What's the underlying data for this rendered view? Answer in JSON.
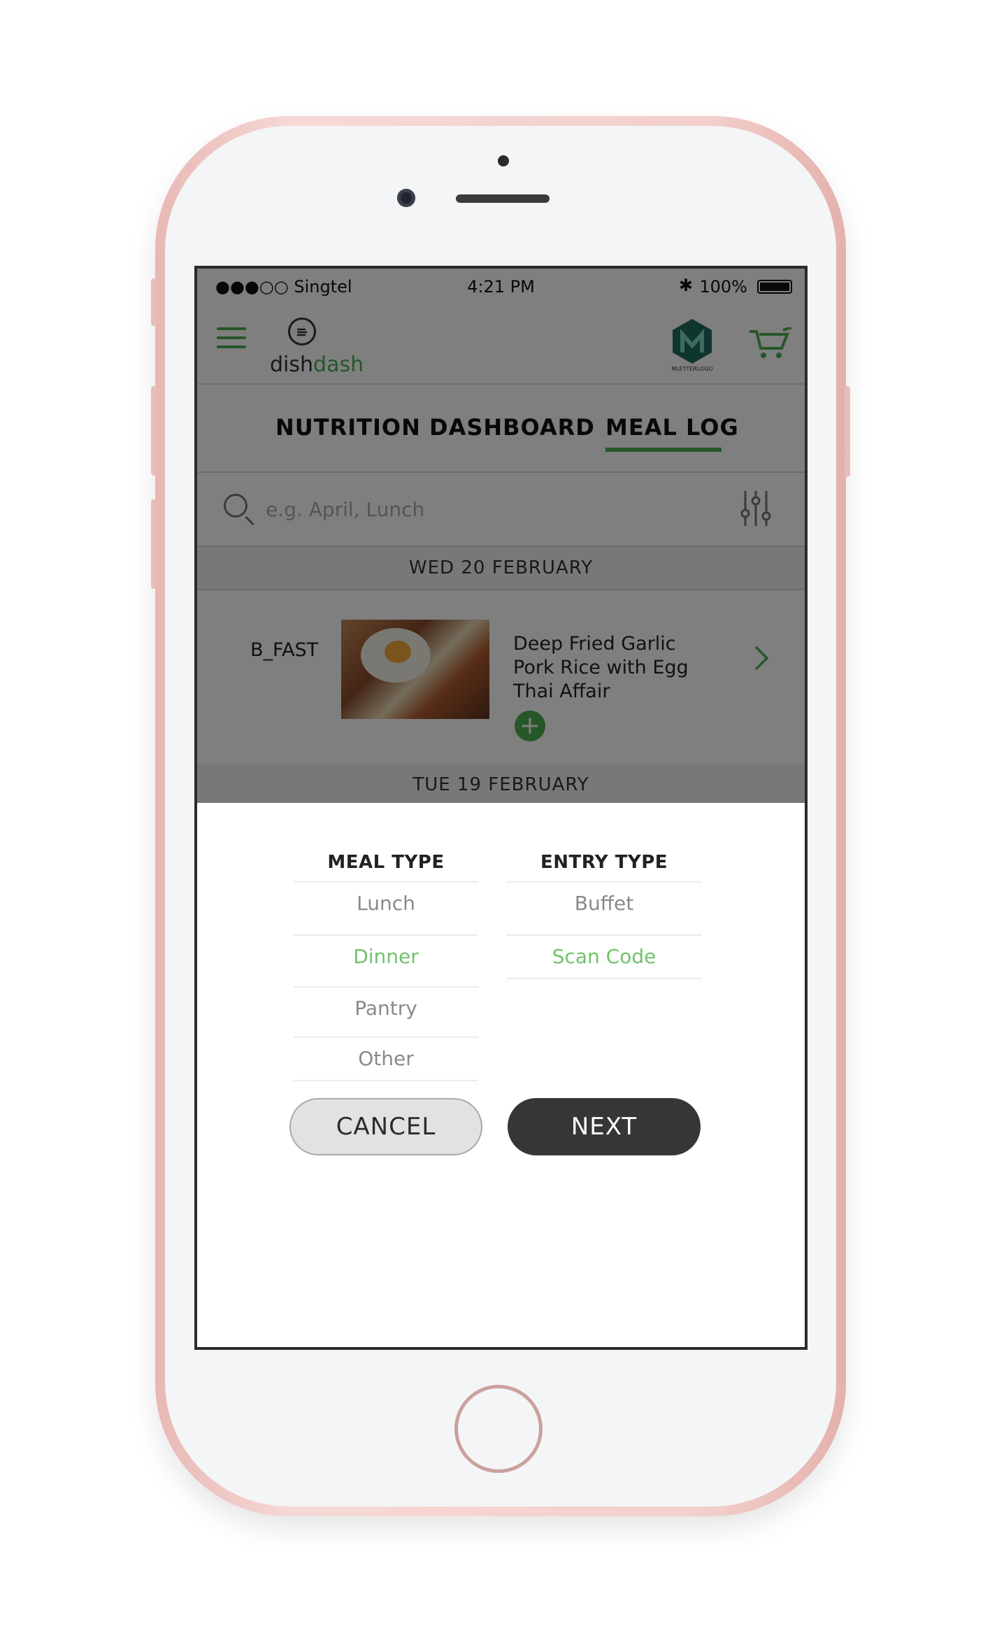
{
  "status_bar": {
    "carrier": "●●●○○ Singtel",
    "time": "4:21 PM",
    "battery": "100%"
  },
  "header": {
    "logo_prefix": "dish",
    "logo_suffix": "dash",
    "brand_logo_text": "MLETTERLOGO",
    "icons": [
      "menu-icon",
      "dishdash-logo-icon",
      "brand-logo-icon",
      "cart-icon"
    ]
  },
  "tabs": [
    {
      "label": "NUTRITION DASHBOARD",
      "active": false
    },
    {
      "label": "MEAL LOG",
      "active": true
    }
  ],
  "search": {
    "placeholder": "e.g. April, Lunch",
    "icon": "search-icon",
    "filter_icon": "filter-sliders-icon"
  },
  "meal_log": {
    "days": [
      {
        "date": "WED 20 FEBRUARY",
        "entries": [
          {
            "meal_type": "B_FAST",
            "name": "Deep Fried Garlic Pork Rice with Egg Thai Affair",
            "add_icon": "plus-icon",
            "chevron_icon": "chevron-right-icon"
          }
        ]
      },
      {
        "date": "TUE 19 FEBRUARY",
        "entries": []
      }
    ]
  },
  "picker": {
    "meal_type": {
      "header": "MEAL TYPE",
      "options": [
        "Lunch",
        "Dinner",
        "Pantry",
        "Other"
      ],
      "selected": "Dinner"
    },
    "entry_type": {
      "header": "ENTRY TYPE",
      "options": [
        "Buffet",
        "Scan Code"
      ],
      "selected": "Scan Code"
    },
    "cancel_label": "CANCEL",
    "next_label": "NEXT"
  },
  "colors": {
    "accent_green": "#4caf50",
    "selected_option": "#72c26b",
    "next_button": "#343736",
    "phone_frame": "#f3cfcb"
  }
}
